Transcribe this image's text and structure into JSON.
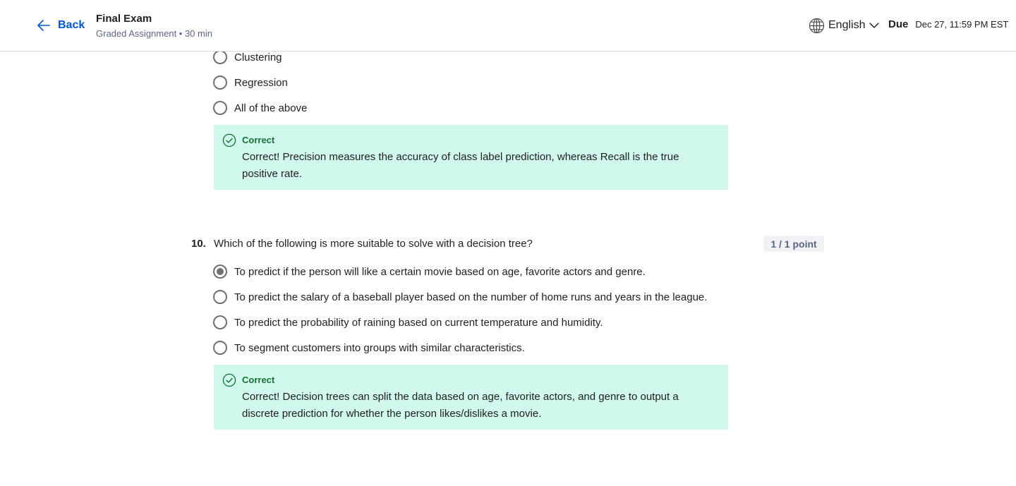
{
  "header": {
    "back_label": "Back",
    "title": "Final Exam",
    "subtitle": "Graded Assignment • 30 min",
    "language": "English",
    "due_label": "Due",
    "due_date": "Dec 27, 11:59 PM EST"
  },
  "prev_question": {
    "options": [
      {
        "label": "Clustering",
        "selected": false
      },
      {
        "label": "Regression",
        "selected": false
      },
      {
        "label": "All of the above",
        "selected": false
      }
    ],
    "feedback": {
      "status": "Correct",
      "text": "Correct! Precision measures the accuracy of class label prediction, whereas Recall is the true positive rate."
    }
  },
  "question10": {
    "number": "10.",
    "text": "Which of the following is more suitable to solve with a decision tree?",
    "points": "1 / 1 point",
    "options": [
      {
        "label": "To predict if the person will like a certain movie based on age, favorite actors and genre.",
        "selected": true
      },
      {
        "label": "To predict the salary of a baseball player based on the number of home runs and years in the league.",
        "selected": false
      },
      {
        "label": "To predict the probability of raining based on current temperature and humidity.",
        "selected": false
      },
      {
        "label": "To segment customers into groups with similar characteristics.",
        "selected": false
      }
    ],
    "feedback": {
      "status": "Correct",
      "text": "Correct! Decision trees can split the data based on age, favorite actors, and genre to output a discrete prediction for whether the person likes/dislikes a movie."
    }
  },
  "colors": {
    "link": "#0056d2",
    "feedback_bg": "#d0f8ec",
    "correct_green": "#137333"
  }
}
